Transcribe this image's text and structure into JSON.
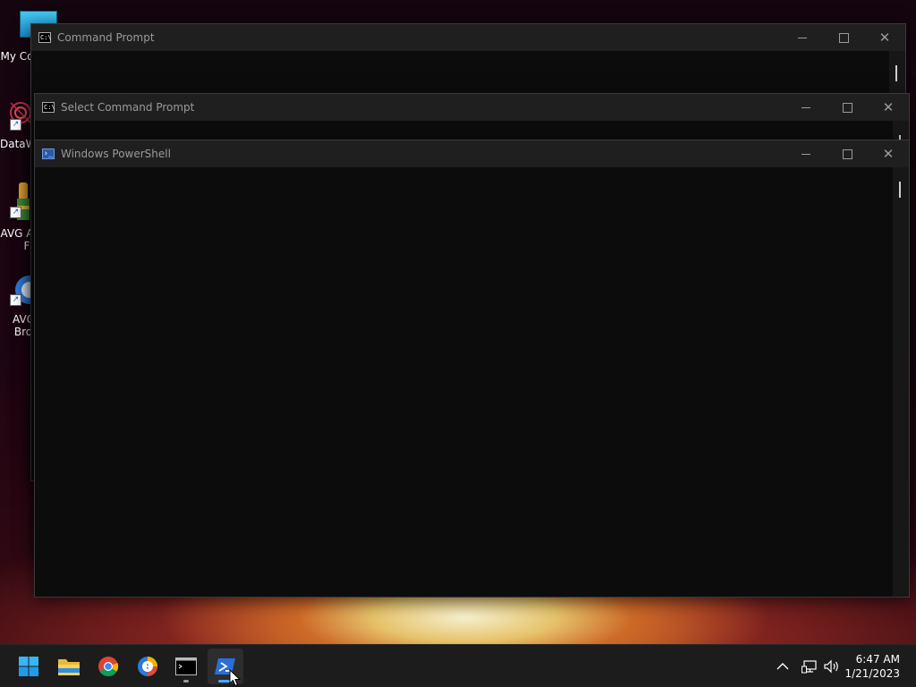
{
  "desktop_icons": [
    {
      "label": "My Co",
      "icon": "monitor-icon"
    },
    {
      "label": "DataW",
      "icon": "datawrapper-icon"
    },
    {
      "label": "AVG A",
      "label2": "F",
      "icon": "avg-antivirus-icon"
    },
    {
      "label": "AVG",
      "label2": "Bro",
      "icon": "avg-browser-icon"
    }
  ],
  "windows": {
    "cmd1": {
      "title": "Command Prompt",
      "icon_text": "C:\\"
    },
    "cmd2": {
      "title": "Select Command Prompt",
      "icon_text": "C:\\"
    },
    "powershell": {
      "title": "Windows PowerShell",
      "icon_text": "›_"
    }
  },
  "window_controls": {
    "minimize": "minimize-icon",
    "maximize": "maximize-icon",
    "close": "close-icon"
  },
  "taskbar": {
    "apps": [
      "start-icon",
      "file-explorer-icon",
      "chrome-icon",
      "avg-browser-icon",
      "command-prompt-icon",
      "powershell-icon"
    ],
    "active_app": "powershell-icon"
  },
  "clock": {
    "time": "6:47 AM",
    "date": "1/21/2023"
  },
  "colors": {
    "titlebar": "#1f1f1f",
    "console": "#0c0c0c",
    "taskbar": "#1c1c1c",
    "accent": "#0078d4"
  }
}
